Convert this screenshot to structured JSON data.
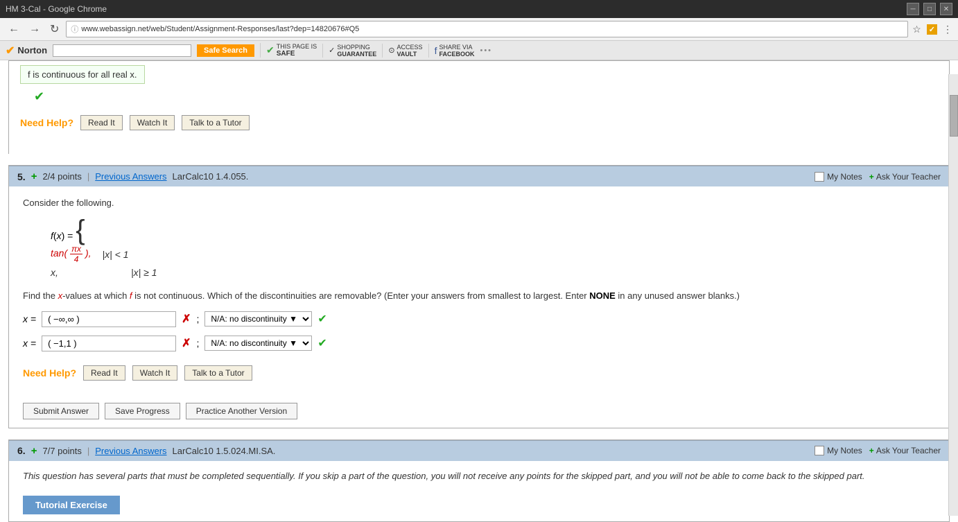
{
  "browser": {
    "title": "HM 3-Cal - Google Chrome",
    "url": "www.webassign.net/web/Student/Assignment-Responses/last?dep=14820676#Q5",
    "back_btn": "←",
    "forward_btn": "→",
    "refresh_btn": "↻"
  },
  "norton": {
    "name": "Norton",
    "search_placeholder": "",
    "safe_search": "Safe Search",
    "page_safe_label": "THIS PAGE IS",
    "page_safe_value": "SAFE",
    "shopping_label": "SHOPPING",
    "shopping_sub": "GUARANTEE",
    "access_label": "ACCESS",
    "access_sub": "VAULT",
    "share_label": "SHARE VIA",
    "share_sub": "FACEBOOK"
  },
  "top_section": {
    "continuous_text": "f is continuous for all real x.",
    "need_help_label": "Need Help?",
    "read_it_btn": "Read It",
    "watch_it_btn": "Watch It",
    "talk_tutor_btn": "Talk to a Tutor"
  },
  "question5": {
    "number": "5.",
    "plus_icon": "+",
    "points": "2/4 points",
    "sep": "|",
    "prev_answers": "Previous Answers",
    "reference": "LarCalc10 1.4.055.",
    "my_notes_label": "My Notes",
    "ask_teacher_label": "Ask Your Teacher",
    "intro": "Consider the following.",
    "instruction": "Find the x-values at which f is not continuous. Which of the discontinuities are removable? (Enter your answers from smallest to largest. Enter NONE in any unused answer blanks.)",
    "row1_label": "x =",
    "row1_input": "( −∞,∞ )",
    "row1_dropdown": "N/A: no discontinuity",
    "row2_label": "x =",
    "row2_input": "( −1,1 )",
    "row2_dropdown": "N/A: no discontinuity",
    "need_help_label": "Need Help?",
    "read_it_btn": "Read It",
    "watch_it_btn": "Watch It",
    "talk_tutor_btn": "Talk to a Tutor",
    "submit_btn": "Submit Answer",
    "save_btn": "Save Progress",
    "practice_btn": "Practice Another Version"
  },
  "question6": {
    "number": "6.",
    "plus_icon": "+",
    "points": "7/7 points",
    "sep": "|",
    "prev_answers": "Previous Answers",
    "reference": "LarCalc10 1.5.024.MI.SA.",
    "my_notes_label": "My Notes",
    "ask_teacher_label": "Ask Your Teacher",
    "body_text": "This question has several parts that must be completed sequentially. If you skip a part of the question, you will not receive any points for the skipped part, and you will not be able to come back to the skipped part.",
    "tutorial_btn": "Tutorial Exercise"
  }
}
